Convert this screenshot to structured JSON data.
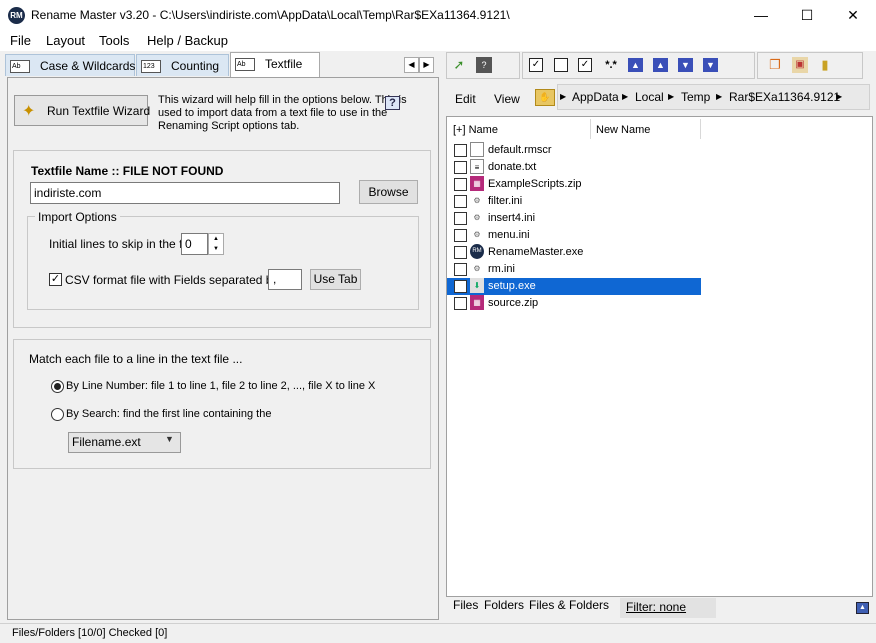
{
  "window": {
    "title": "Rename Master v3.20 - C:\\Users\\indiriste.com\\AppData\\Local\\Temp\\Rar$EXa11364.9121\\",
    "icon_text": "RM",
    "minimize": "—",
    "maximize": "☐",
    "close": "✕"
  },
  "menu": [
    "File",
    "Layout",
    "Tools",
    "Help /  Backup"
  ],
  "tabs": {
    "items": [
      {
        "label": "Case & Wildcards",
        "icon": "Ab"
      },
      {
        "label": "Counting",
        "icon": "123"
      },
      {
        "label": "Textfile",
        "icon": "Ab"
      }
    ],
    "active": "Textfile",
    "prev": "◀",
    "next": "▶"
  },
  "wizard": {
    "button_label": "Run Textfile Wizard",
    "description": "This wizard will help fill in the options below. This is used to import data from a text file to use in the Renaming Script options tab.",
    "help_icon": "?"
  },
  "textfile": {
    "title": "Textfile Name :: FILE NOT FOUND",
    "value": "indiriste.com",
    "browse_label": "Browse"
  },
  "import": {
    "group_label": "Import Options",
    "skip_label": "Initial lines to skip in the file",
    "skip_value": "0",
    "spin_up": "▲",
    "spin_down": "▼",
    "csv_checked": true,
    "csv_check_glyph": "✓",
    "csv_label": "CSV format file with Fields separated by",
    "separator": ",",
    "usetab_label": "Use Tab"
  },
  "match": {
    "label": "Match each file to a line in the text file  ...",
    "option1": "By Line Number:   file 1 to line 1, file 2 to line 2, ..., file X to line X",
    "option2": "By Search: find the first line containing the",
    "selected": "By Line Number",
    "select_value": "Filename.ext"
  },
  "right": {
    "edit_label": "Edit",
    "view_label": "View",
    "breadcrumb": [
      "AppData",
      "Local",
      "Temp",
      "Rar$EXa11364.9121"
    ],
    "columns": {
      "name": "[+] Name",
      "new_name": "New Name"
    },
    "files": [
      {
        "name": "default.rmscr",
        "icon": "doc-icon",
        "selected": false
      },
      {
        "name": "donate.txt",
        "icon": "text-file-icon",
        "selected": false
      },
      {
        "name": "ExampleScripts.zip",
        "icon": "archive-icon",
        "selected": false
      },
      {
        "name": "filter.ini",
        "icon": "settings-file-icon",
        "selected": false
      },
      {
        "name": "insert4.ini",
        "icon": "settings-file-icon",
        "selected": false
      },
      {
        "name": "menu.ini",
        "icon": "settings-file-icon",
        "selected": false
      },
      {
        "name": "RenameMaster.exe",
        "icon": "app-icon",
        "selected": false
      },
      {
        "name": "rm.ini",
        "icon": "settings-file-icon",
        "selected": false
      },
      {
        "name": "setup.exe",
        "icon": "installer-icon",
        "selected": true
      },
      {
        "name": "source.zip",
        "icon": "archive-icon",
        "selected": false
      }
    ],
    "bottom_tabs": [
      "Files",
      "Folders",
      "Files & Folders"
    ],
    "filter_label": "Filter:  none"
  },
  "status": "Files/Folders [10/0] Checked [0]",
  "colors": {
    "selection": "#0f67d3",
    "tab_inactive": "#dbe7f3",
    "toolbar_arrow": "#3a4fb8"
  }
}
